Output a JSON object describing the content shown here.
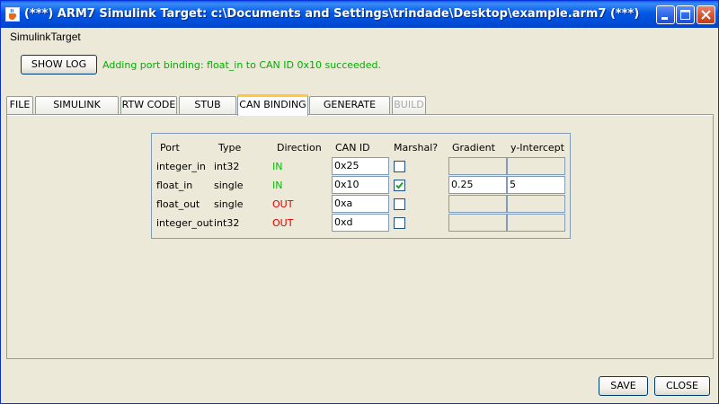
{
  "window": {
    "title": "(***) ARM7 Simulink Target: c:\\Documents and Settings\\trindade\\Desktop\\example.arm7 (***)"
  },
  "menu": {
    "items": [
      {
        "label": "SimulinkTarget"
      }
    ]
  },
  "toolbar": {
    "show_log_label": "SHOW LOG",
    "status_message": "Adding port binding: float_in to CAN ID 0x10 succeeded.",
    "status_color": "#00b000"
  },
  "tabs": [
    {
      "label": "FILE",
      "state": "normal"
    },
    {
      "label": "SIMULINK MODEL",
      "state": "normal"
    },
    {
      "label": "RTW CODE",
      "state": "normal"
    },
    {
      "label": "STUB CODE",
      "state": "normal"
    },
    {
      "label": "CAN BINDING",
      "state": "active"
    },
    {
      "label": "GENERATE CODE",
      "state": "normal"
    },
    {
      "label": "BUILD",
      "state": "disabled"
    }
  ],
  "binding_table": {
    "headers": {
      "port": "Port",
      "type": "Type",
      "direction": "Direction",
      "can_id": "CAN ID",
      "marshal": "Marshal?",
      "gradient": "Gradient",
      "intercept": "y-Intercept"
    },
    "rows": [
      {
        "port": "integer_in",
        "type": "int32",
        "direction": "IN",
        "can_id": "0x25",
        "marshal": false,
        "gradient": "",
        "intercept": ""
      },
      {
        "port": "float_in",
        "type": "single",
        "direction": "IN",
        "can_id": "0x10",
        "marshal": true,
        "gradient": "0.25",
        "intercept": "5"
      },
      {
        "port": "float_out",
        "type": "single",
        "direction": "OUT",
        "can_id": "0xa",
        "marshal": false,
        "gradient": "",
        "intercept": ""
      },
      {
        "port": "integer_out",
        "type": "int32",
        "direction": "OUT",
        "can_id": "0xd",
        "marshal": false,
        "gradient": "",
        "intercept": ""
      }
    ],
    "colors": {
      "in": "#00c000",
      "out": "#e00000"
    }
  },
  "footer": {
    "save_label": "SAVE",
    "close_label": "CLOSE"
  },
  "icons": {
    "app": "java-cup-icon",
    "minimize": "minimize-icon",
    "maximize": "maximize-icon",
    "close": "close-icon",
    "check": "checkmark-icon"
  }
}
